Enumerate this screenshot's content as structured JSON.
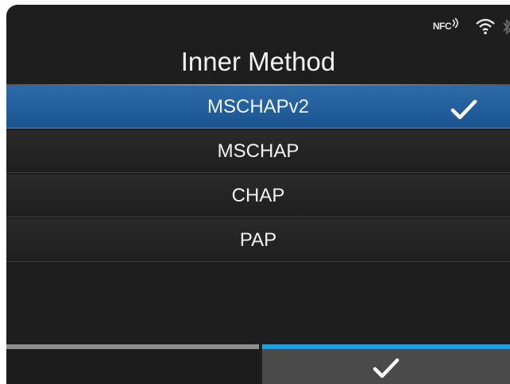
{
  "status": {
    "nfc_label": "NFC"
  },
  "title": "Inner Method",
  "options": [
    {
      "label": "MSCHAPv2",
      "selected": true
    },
    {
      "label": "MSCHAP",
      "selected": false
    },
    {
      "label": "CHAP",
      "selected": false
    },
    {
      "label": "PAP",
      "selected": false
    }
  ],
  "colors": {
    "selected_row": "#1f5c9c",
    "confirm_accent": "#1aa0e6",
    "background": "#1e1e1e"
  },
  "icons": {
    "selected_marker": "checkmark-icon",
    "confirm_button": "checkmark-icon",
    "left_button": "blank"
  }
}
